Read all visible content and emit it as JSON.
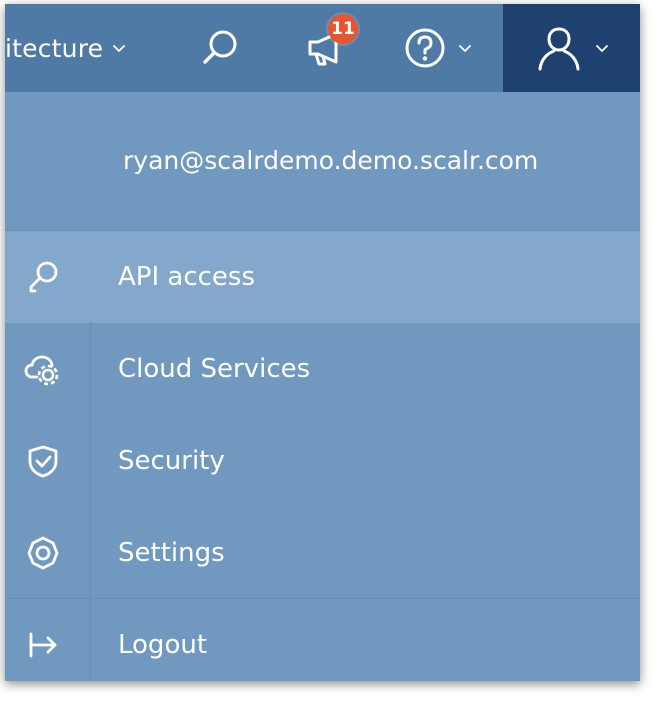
{
  "topbar": {
    "breadcrumb_text": "itecture",
    "search_icon": "search-icon",
    "announcements_icon": "megaphone-icon",
    "announcements_count": "11",
    "help_icon": "help-icon",
    "user_icon": "user-icon",
    "colors": {
      "bar": "#4f7aa6",
      "user_active": "#1e416f",
      "badge": "#e8542d"
    }
  },
  "dropdown": {
    "email": "ryan@scalrdemo.demo.scalr.com",
    "items": [
      {
        "label": "API access",
        "icon": "key-icon",
        "active": true
      },
      {
        "label": "Cloud Services",
        "icon": "cloud-gear-icon",
        "active": false
      },
      {
        "label": "Security",
        "icon": "shield-icon",
        "active": false
      },
      {
        "label": "Settings",
        "icon": "gear-icon",
        "active": false
      },
      {
        "label": "Logout",
        "icon": "logout-icon",
        "active": false
      }
    ],
    "colors": {
      "background": "#7198bf",
      "active": "#84a8cb"
    }
  }
}
